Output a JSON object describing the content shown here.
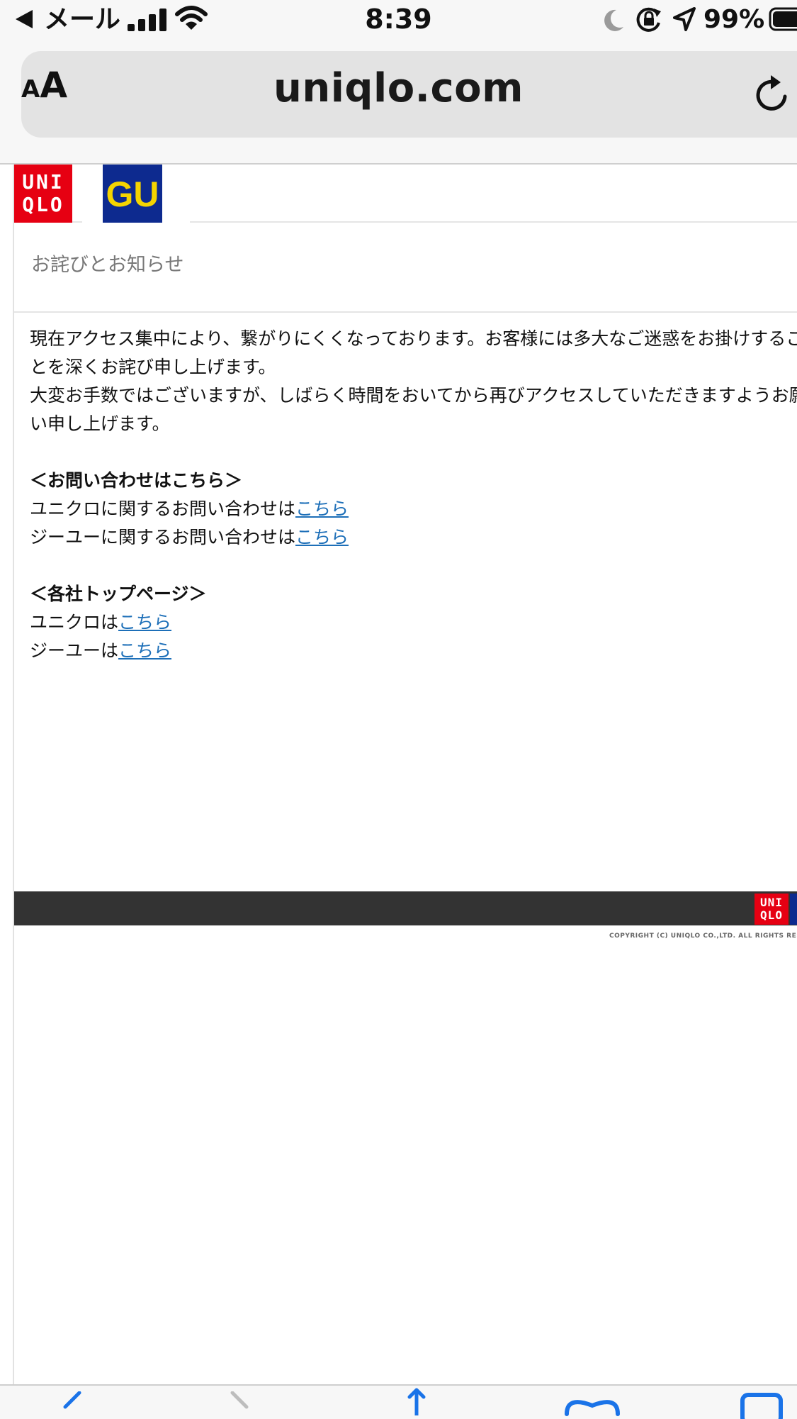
{
  "status_bar": {
    "carrier": "メール",
    "time": "8:39",
    "battery": "99%"
  },
  "browser": {
    "text_size_label_small": "A",
    "text_size_label_large": "A",
    "url": "uniqlo.com"
  },
  "logos": {
    "uniqlo_line1": "UNI",
    "uniqlo_line2": "QLO",
    "gu": "GU"
  },
  "notice": {
    "title": "お詫びとお知らせ",
    "paragraph1": "現在アクセス集中により、繋がりにくくなっております。お客様には多大なご迷惑をお掛けすることを深くお詫び申し上げます。",
    "paragraph2": "大変お手数ではございますが、しばらく時間をおいてから再びアクセスしていただきますようお願い申し上げます。"
  },
  "contact": {
    "heading": "＜お問い合わせはこちら＞",
    "uniqlo_text": "ユニクロに関するお問い合わせは",
    "uniqlo_link": "こちら",
    "gu_text": "ジーユーに関するお問い合わせは",
    "gu_link": "こちら"
  },
  "top_pages": {
    "heading": "＜各社トップページ＞",
    "uniqlo_text": "ユニクロは",
    "uniqlo_link": "こちら",
    "gu_text": "ジーユーは",
    "gu_link": "こちら"
  },
  "footer": {
    "logo_line1": "UNI",
    "logo_line2": "QLO",
    "copyright": "COPYRIGHT (C) UNIQLO CO.,LTD. ALL RIGHTS RESERVED."
  },
  "icons": {
    "back": "back-arrow-icon",
    "signal": "cellular-signal-icon",
    "wifi": "wifi-icon",
    "moon": "do-not-disturb-moon-icon",
    "rotation_lock": "rotation-lock-icon",
    "location": "location-arrow-icon",
    "battery": "battery-icon",
    "reload": "reload-icon"
  },
  "colors": {
    "uniqlo_red": "#e60012",
    "gu_blue": "#0d2a8f",
    "gu_yellow": "#f5d400",
    "link_blue": "#1d6fb8",
    "footer_dark": "#333333"
  }
}
